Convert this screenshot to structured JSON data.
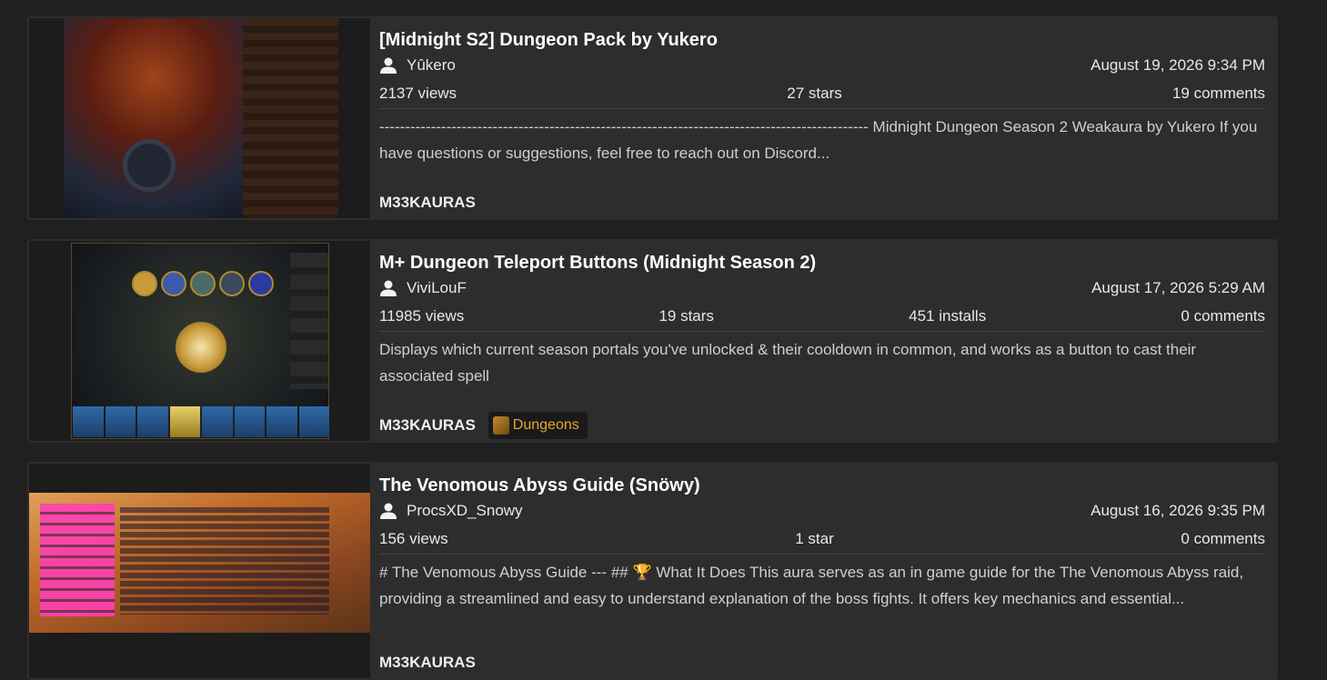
{
  "cards": [
    {
      "title": "[Midnight S2] Dungeon Pack by Yukero",
      "author": "Yûkero",
      "date": "August 19, 2026 9:34 PM",
      "views": "2137 views",
      "stars": "27 stars",
      "comments": "19 comments",
      "description": "----------------------------------------------------------------------------------------------- Midnight Dungeon Season 2 Weakaura by Yukero If you have questions or suggestions, feel free to reach out on Discord...",
      "source": "M33KAURAS"
    },
    {
      "title": "M+ Dungeon Teleport Buttons (Midnight Season 2)",
      "author": "ViviLouF",
      "date": "August 17, 2026 5:29 AM",
      "views": "11985 views",
      "stars": "19 stars",
      "installs": "451 installs",
      "comments": "0 comments",
      "description": "Displays which current season portals you've unlocked & their cooldown in common, and works as a button to cast their associated spell",
      "source": "M33KAURAS",
      "tag": "Dungeons"
    },
    {
      "title": "The Venomous Abyss Guide (Snöwy)",
      "author": "ProcsXD_Snowy",
      "date": "August 16, 2026 9:35 PM",
      "views": "156 views",
      "stars": "1 star",
      "comments": "0 comments",
      "description": "# The Venomous Abyss Guide --- ## 🏆 What It Does This aura serves as an in game guide for the The Venomous Abyss raid, providing a streamlined and easy to understand explanation of the boss fights. It offers key mechanics and essential...",
      "source": "M33KAURAS"
    }
  ],
  "colors": {
    "background": "#202020",
    "card": "#2d2d2d",
    "tag_text": "#e8a531"
  }
}
